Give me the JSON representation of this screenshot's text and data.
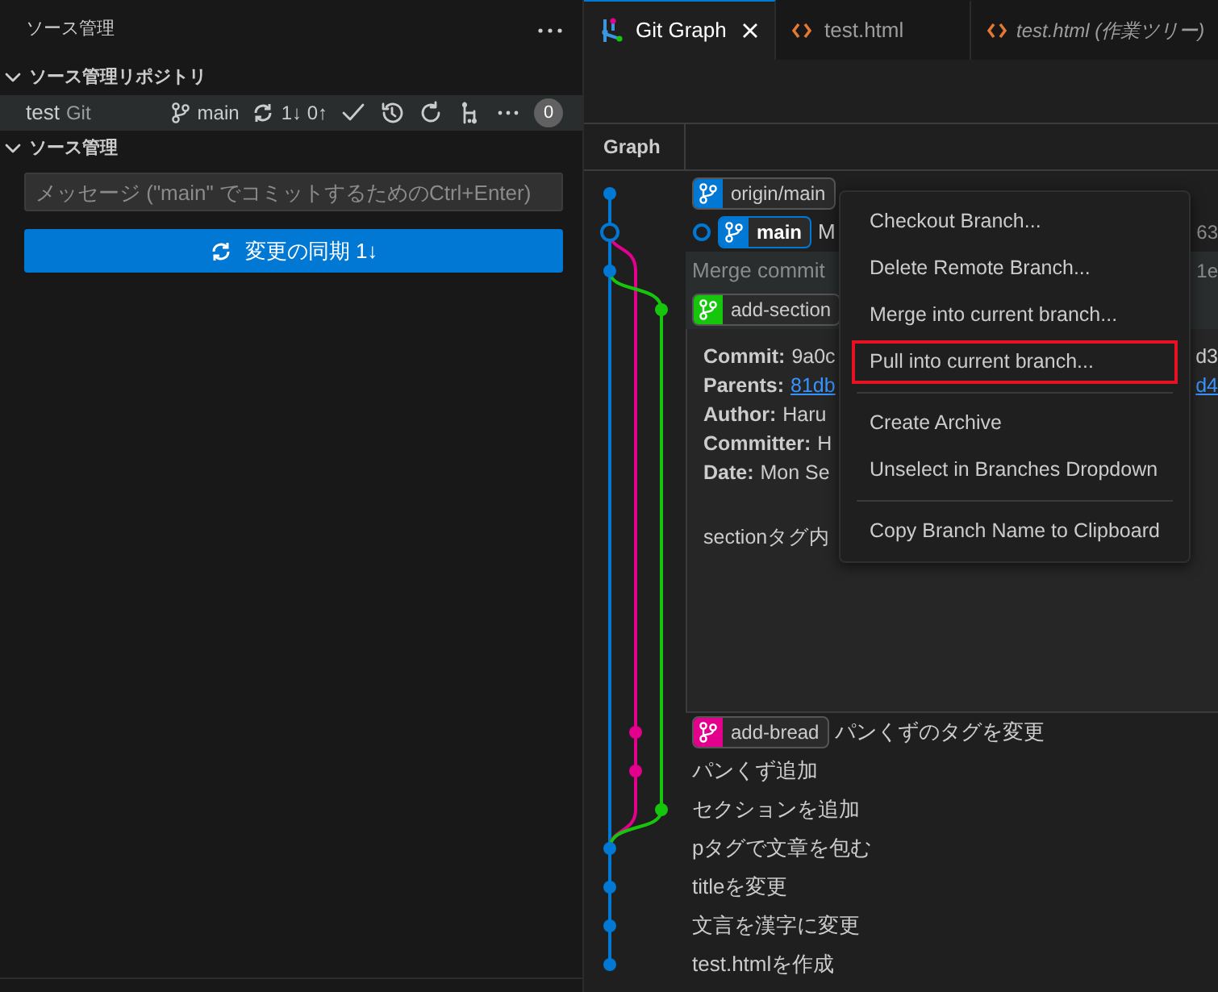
{
  "sidebar": {
    "title": "ソース管理",
    "repositories_section": {
      "title": "ソース管理リポジトリ",
      "expanded": true
    },
    "repository": {
      "name": "test",
      "provider": "Git",
      "branch": "main",
      "sync": "1↓ 0↑",
      "badge": "0",
      "selected": true
    },
    "changes_section": {
      "title": "ソース管理",
      "expanded": true
    },
    "message": {
      "placeholder": "メッセージ (\"main\" でコミットするためのCtrl+Enter)"
    },
    "sync_button": "変更の同期 1↓"
  },
  "tabs": [
    {
      "label": "Git Graph",
      "kind": "graph",
      "selected": true,
      "preview": false
    },
    {
      "label": "test.html",
      "kind": "html",
      "selected": false,
      "preview": false
    },
    {
      "label": "test.html (作業ツリー)",
      "kind": "html",
      "selected": false,
      "preview": true
    }
  ],
  "graph": {
    "column": "Graph",
    "commits": [
      {
        "kind": "first",
        "color": "#0078d4",
        "head": false,
        "highlighted": false,
        "refs": [
          {
            "name": "origin/main",
            "color": "#0078d4",
            "current": false
          }
        ]
      },
      {
        "kind": "first",
        "color": "#0078d4",
        "head": true,
        "highlighted": false,
        "refs": [
          {
            "name": "main",
            "color": "#0078d4",
            "current": true
          }
        ],
        "message": "M",
        "column_3": "63"
      },
      {
        "kind": "first",
        "color": "#0078d4",
        "head": false,
        "highlighted": true,
        "message": "Merge commit",
        "column_3": "1e"
      },
      {
        "kind": "third",
        "color": "#16c60c",
        "head": false,
        "highlighted": true,
        "refs": [
          {
            "name": "add-section",
            "color": "#16c60c",
            "current": false
          }
        ],
        "details": {
          "fields": [
            {
              "label": "Commit:",
              "value": "9a0c",
              "link": false,
              "column_3": "d3"
            },
            {
              "label": "Parents:",
              "value": "81db",
              "link": true,
              "column_3": "d4"
            },
            {
              "label": "Author:",
              "value": "Haru",
              "link": false
            },
            {
              "label": "Committer:",
              "value": "H",
              "link": false
            },
            {
              "label": "Date:",
              "value": "Mon Se",
              "link": false
            }
          ],
          "body": "sectionタグ内"
        }
      },
      {
        "kind": "second",
        "color": "#e3008c",
        "head": false,
        "highlighted": false,
        "refs": [
          {
            "name": "add-bread",
            "color": "#e3008c",
            "current": false
          }
        ],
        "message": "パンくずのタグを変更"
      },
      {
        "kind": "second",
        "color": "#e3008c",
        "head": false,
        "highlighted": false,
        "message": "パンくず追加"
      },
      {
        "kind": "third",
        "color": "#16c60c",
        "head": false,
        "highlighted": false,
        "message": "セクションを追加"
      },
      {
        "kind": "first",
        "color": "#0078d4",
        "head": false,
        "highlighted": false,
        "message": "pタグで文章を包む"
      },
      {
        "kind": "first",
        "color": "#0078d4",
        "head": false,
        "highlighted": false,
        "message": "titleを変更"
      },
      {
        "kind": "first",
        "color": "#0078d4",
        "head": false,
        "highlighted": false,
        "message": "文言を漢字に変更"
      },
      {
        "kind": "first",
        "color": "#0078d4",
        "head": false,
        "highlighted": false,
        "message": "test.htmlを作成"
      }
    ]
  },
  "context_menu": {
    "groups": [
      [
        {
          "label": "Checkout Branch...",
          "outlined": false
        },
        {
          "label": "Delete Remote Branch...",
          "outlined": false
        },
        {
          "label": "Merge into current branch...",
          "outlined": false
        },
        {
          "label": "Pull into current branch...",
          "outlined": true
        }
      ],
      [
        {
          "label": "Create Archive",
          "outlined": false
        },
        {
          "label": "Unselect in Branches Dropdown",
          "outlined": false
        }
      ],
      [
        {
          "label": "Copy Branch Name to Clipboard",
          "outlined": false
        }
      ]
    ]
  }
}
